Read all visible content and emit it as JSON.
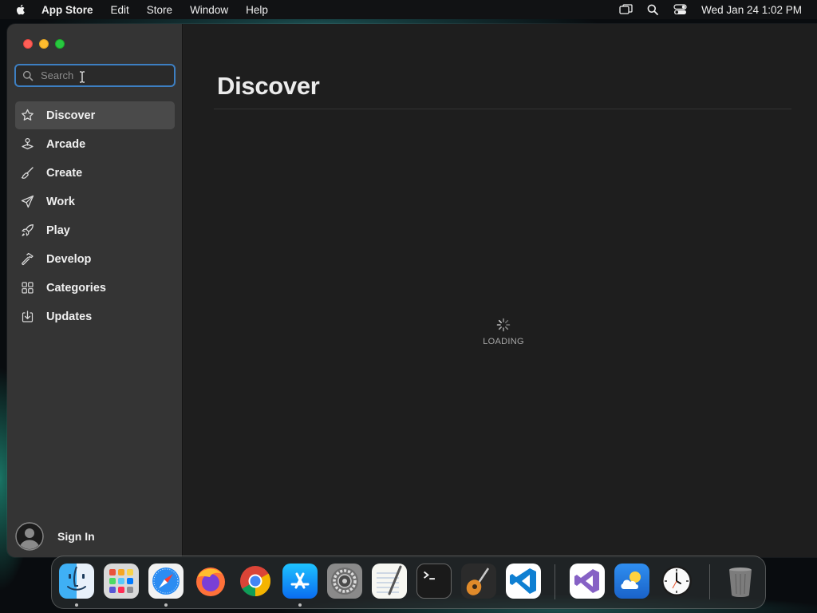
{
  "menubar": {
    "app_name": "App Store",
    "items": [
      "Edit",
      "Store",
      "Window",
      "Help"
    ],
    "clock": "Wed Jan 24  1:02 PM"
  },
  "window": {
    "search": {
      "placeholder": "Search",
      "value": ""
    },
    "nav": [
      {
        "label": "Discover",
        "icon": "star-icon",
        "active": true
      },
      {
        "label": "Arcade",
        "icon": "joystick-icon",
        "active": false
      },
      {
        "label": "Create",
        "icon": "paintbrush-icon",
        "active": false
      },
      {
        "label": "Work",
        "icon": "paper-plane-icon",
        "active": false
      },
      {
        "label": "Play",
        "icon": "rocket-icon",
        "active": false
      },
      {
        "label": "Develop",
        "icon": "hammer-icon",
        "active": false
      },
      {
        "label": "Categories",
        "icon": "grid-icon",
        "active": false
      },
      {
        "label": "Updates",
        "icon": "download-icon",
        "active": false
      }
    ],
    "signin_label": "Sign In",
    "page_title": "Discover",
    "loading_label": "LOADING"
  },
  "dock": {
    "apps": [
      "Finder",
      "Launchpad",
      "Safari",
      "Firefox",
      "Chrome",
      "App Store",
      "System Settings",
      "TextEdit",
      "Terminal",
      "GarageBand",
      "Visual Studio Code",
      "Visual Studio",
      "Weather",
      "Clock",
      "Trash"
    ],
    "running": [
      "Finder",
      "Safari",
      "App Store"
    ]
  },
  "colors": {
    "accent_focus": "#3d7fc2",
    "sidebar_bg": "#343434",
    "content_bg": "#1e1e1e"
  }
}
